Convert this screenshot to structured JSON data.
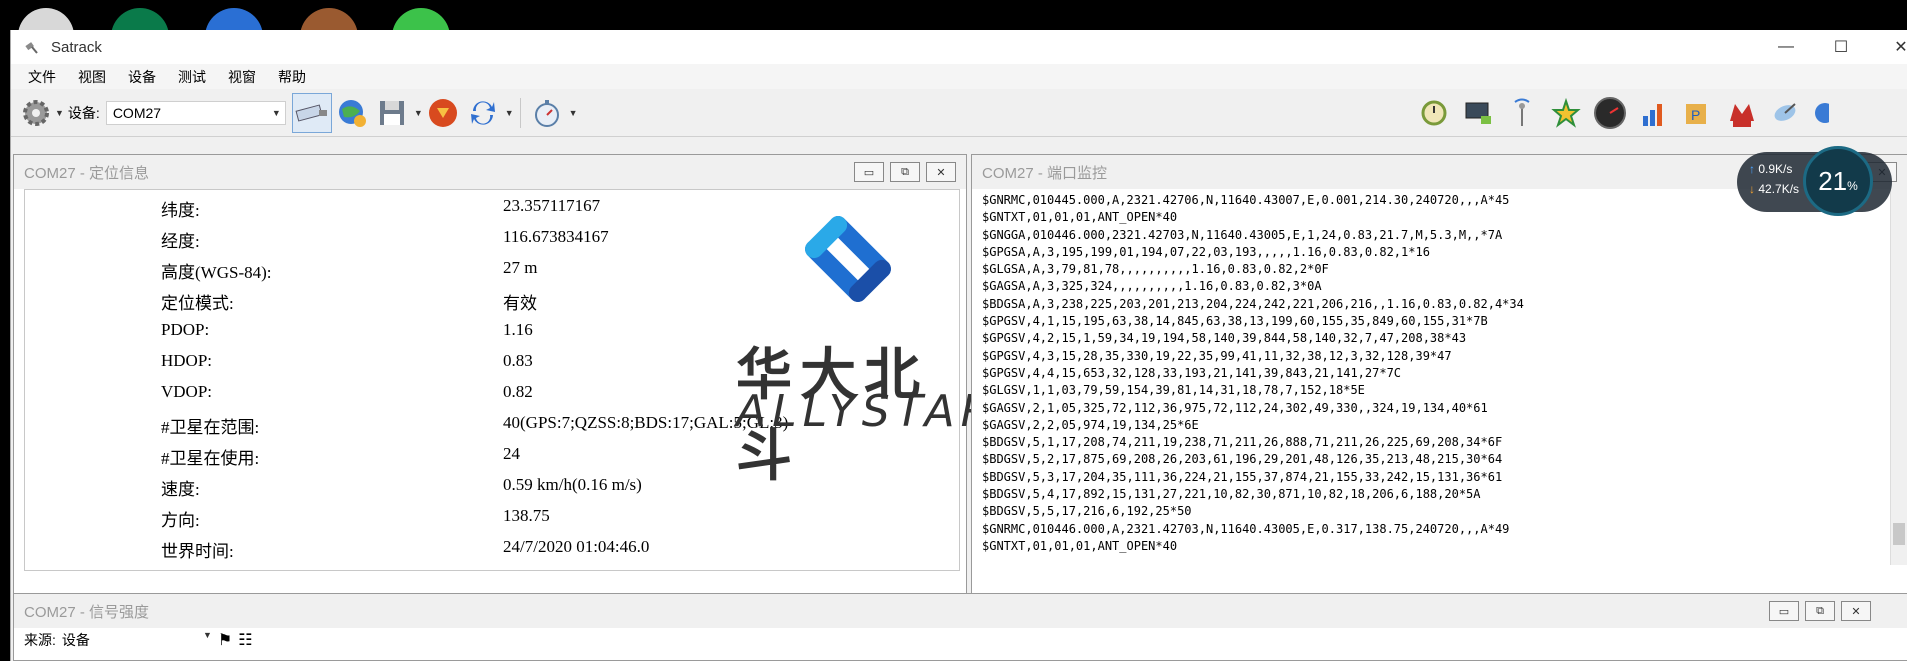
{
  "window": {
    "title": "Satrack"
  },
  "menu": [
    "文件",
    "视图",
    "设备",
    "测试",
    "视窗",
    "帮助"
  ],
  "toolbar": {
    "device_label": "设备:",
    "device_value": "COM27"
  },
  "position_panel": {
    "title": "COM27 - 定位信息",
    "rows": [
      {
        "label": "纬度:",
        "value": "23.357117167"
      },
      {
        "label": "经度:",
        "value": "116.673834167"
      },
      {
        "label": "高度(WGS-84):",
        "value": "27 m"
      },
      {
        "label": "定位模式:",
        "value": "有效"
      },
      {
        "label": "PDOP:",
        "value": "1.16"
      },
      {
        "label": "HDOP:",
        "value": "0.83"
      },
      {
        "label": "VDOP:",
        "value": "0.82"
      },
      {
        "label": "#卫星在范围:",
        "value": "40(GPS:7;QZSS:8;BDS:17;GAL:5;GL:3)"
      },
      {
        "label": "#卫星在使用:",
        "value": "24"
      },
      {
        "label": "速度:",
        "value": "0.59 km/h(0.16 m/s)"
      },
      {
        "label": "方向:",
        "value": "138.75"
      },
      {
        "label": "世界时间:",
        "value": "24/7/2020 01:04:46.0"
      }
    ]
  },
  "watermark": {
    "cn": "华大北斗",
    "en": "ALLYSTAR"
  },
  "port_panel": {
    "title": "COM27 - 端口监控",
    "lines": [
      "$GNRMC,010445.000,A,2321.42706,N,11640.43007,E,0.001,214.30,240720,,,A*45",
      "$GNTXT,01,01,01,ANT_OPEN*40",
      "$GNGGA,010446.000,2321.42703,N,11640.43005,E,1,24,0.83,21.7,M,5.3,M,,*7A",
      "$GPGSA,A,3,195,199,01,194,07,22,03,193,,,,,1.16,0.83,0.82,1*16",
      "$GLGSA,A,3,79,81,78,,,,,,,,,,1.16,0.83,0.82,2*0F",
      "$GAGSA,A,3,325,324,,,,,,,,,,1.16,0.83,0.82,3*0A",
      "$BDGSA,A,3,238,225,203,201,213,204,224,242,221,206,216,,1.16,0.83,0.82,4*34",
      "$GPGSV,4,1,15,195,63,38,14,845,63,38,13,199,60,155,35,849,60,155,31*7B",
      "$GPGSV,4,2,15,1,59,34,19,194,58,140,39,844,58,140,32,7,47,208,38*43",
      "$GPGSV,4,3,15,28,35,330,19,22,35,99,41,11,32,38,12,3,32,128,39*47",
      "$GPGSV,4,4,15,653,32,128,33,193,21,141,39,843,21,141,27*7C",
      "$GLGSV,1,1,03,79,59,154,39,81,14,31,18,78,7,152,18*5E",
      "$GAGSV,2,1,05,325,72,112,36,975,72,112,24,302,49,330,,324,19,134,40*61",
      "$GAGSV,2,2,05,974,19,134,25*6E",
      "$BDGSV,5,1,17,208,74,211,19,238,71,211,26,888,71,211,26,225,69,208,34*6F",
      "$BDGSV,5,2,17,875,69,208,26,203,61,196,29,201,48,126,35,213,48,215,30*64",
      "$BDGSV,5,3,17,204,35,111,36,224,21,155,37,874,21,155,33,242,15,131,36*61",
      "$BDGSV,5,4,17,892,15,131,27,221,10,82,30,871,10,82,18,206,6,188,20*5A",
      "$BDGSV,5,5,17,216,6,192,25*50",
      "$GNRMC,010446.000,A,2321.42703,N,11640.43005,E,0.317,138.75,240720,,,A*49",
      "$GNTXT,01,01,01,ANT_OPEN*40"
    ]
  },
  "signal_panel": {
    "title": "COM27 - 信号强度",
    "source_label": "来源:",
    "source_value": "设备"
  },
  "speed_widget": {
    "up": "0.9K/s",
    "down": "42.7K/s",
    "percent": "21",
    "percent_unit": "%"
  }
}
